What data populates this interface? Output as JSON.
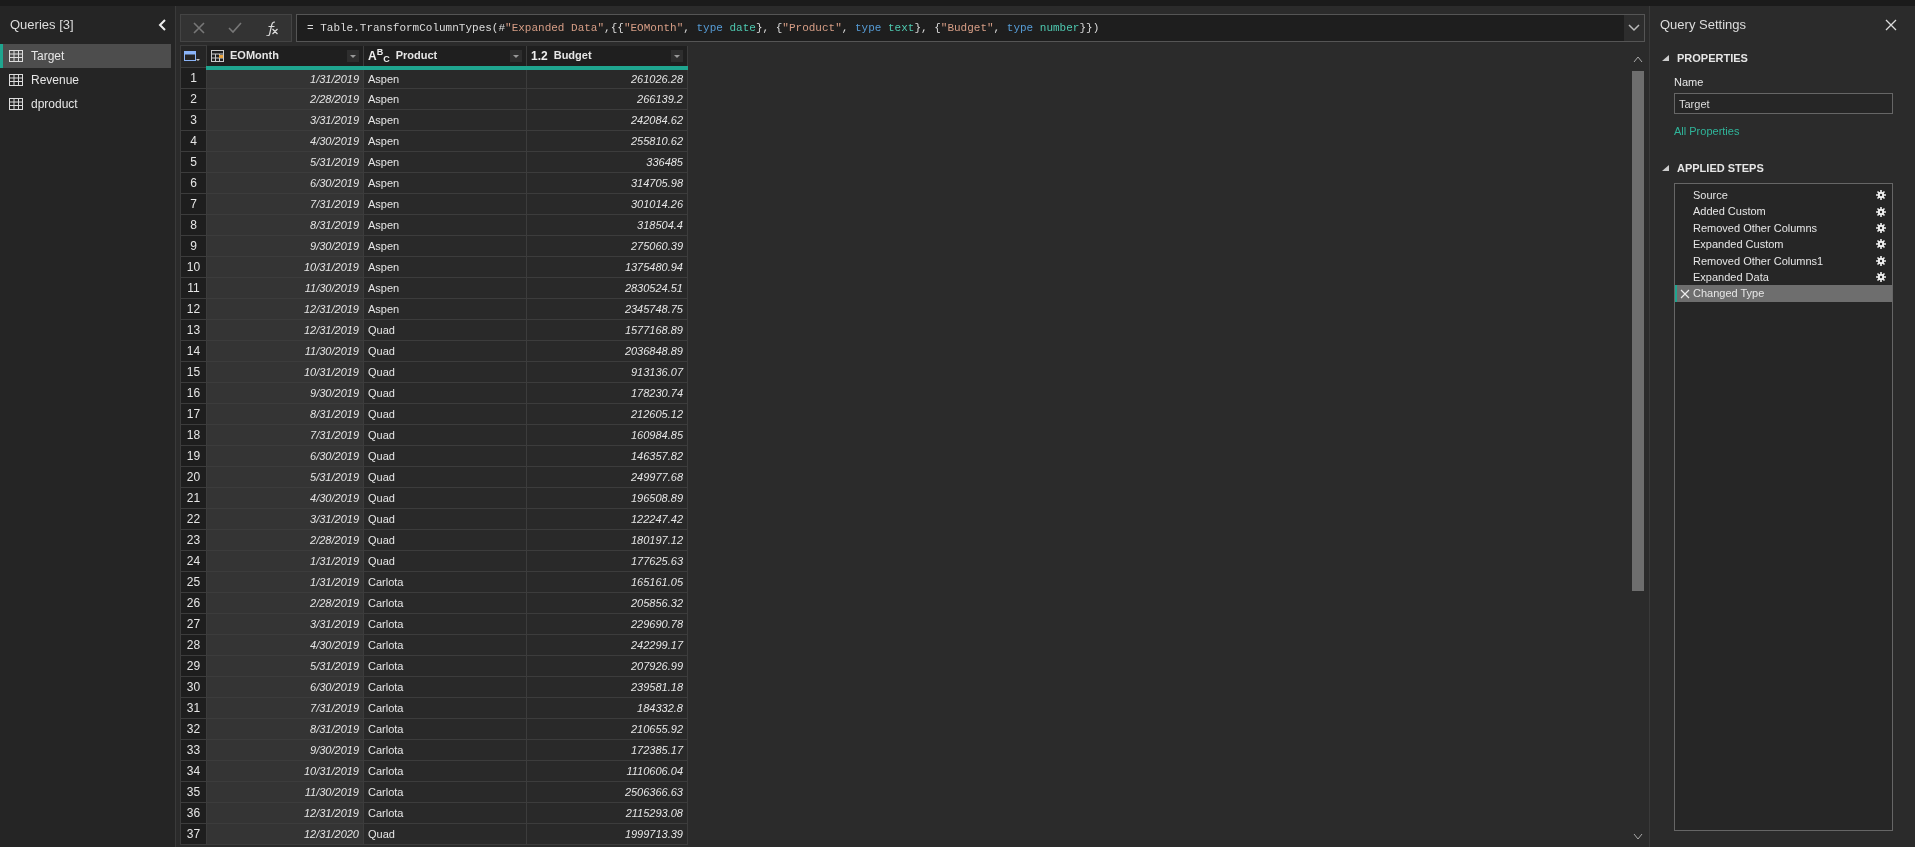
{
  "queries": {
    "title": "Queries [3]",
    "items": [
      {
        "label": "Target",
        "selected": true
      },
      {
        "label": "Revenue",
        "selected": false
      },
      {
        "label": "dproduct",
        "selected": false
      }
    ]
  },
  "formula": [
    {
      "kind": "plain",
      "text": "= Table.TransformColumnTypes(#"
    },
    {
      "kind": "string",
      "text": "\"Expanded Data\""
    },
    {
      "kind": "plain",
      "text": ",{{"
    },
    {
      "kind": "string",
      "text": "\"EOMonth\""
    },
    {
      "kind": "plain",
      "text": ", "
    },
    {
      "kind": "keyword",
      "text": "type"
    },
    {
      "kind": "type",
      "text": " date"
    },
    {
      "kind": "plain",
      "text": "}, {"
    },
    {
      "kind": "string",
      "text": "\"Product\""
    },
    {
      "kind": "plain",
      "text": ", "
    },
    {
      "kind": "keyword",
      "text": "type"
    },
    {
      "kind": "type",
      "text": " text"
    },
    {
      "kind": "plain",
      "text": "}, {"
    },
    {
      "kind": "string",
      "text": "\"Budget\""
    },
    {
      "kind": "plain",
      "text": ", "
    },
    {
      "kind": "keyword",
      "text": "type"
    },
    {
      "kind": "type",
      "text": " number"
    },
    {
      "kind": "plain",
      "text": "}})"
    }
  ],
  "table": {
    "columns": [
      {
        "kind": "select"
      },
      {
        "label": "EOMonth",
        "kind": "date"
      },
      {
        "label": "Product",
        "kind": "text",
        "type_label": "A$^{B}$$_{C}$"
      },
      {
        "label": "Budget",
        "kind": "number",
        "type_label": "1.2"
      }
    ],
    "rows": [
      [
        "1",
        "1/31/2019",
        "Aspen",
        "261026.28"
      ],
      [
        "2",
        "2/28/2019",
        "Aspen",
        "266139.2"
      ],
      [
        "3",
        "3/31/2019",
        "Aspen",
        "242084.62"
      ],
      [
        "4",
        "4/30/2019",
        "Aspen",
        "255810.62"
      ],
      [
        "5",
        "5/31/2019",
        "Aspen",
        "336485"
      ],
      [
        "6",
        "6/30/2019",
        "Aspen",
        "314705.98"
      ],
      [
        "7",
        "7/31/2019",
        "Aspen",
        "301014.26"
      ],
      [
        "8",
        "8/31/2019",
        "Aspen",
        "318504.4"
      ],
      [
        "9",
        "9/30/2019",
        "Aspen",
        "275060.39"
      ],
      [
        "10",
        "10/31/2019",
        "Aspen",
        "1375480.94"
      ],
      [
        "11",
        "11/30/2019",
        "Aspen",
        "2830524.51"
      ],
      [
        "12",
        "12/31/2019",
        "Aspen",
        "2345748.75"
      ],
      [
        "13",
        "12/31/2019",
        "Quad",
        "1577168.89"
      ],
      [
        "14",
        "11/30/2019",
        "Quad",
        "2036848.89"
      ],
      [
        "15",
        "10/31/2019",
        "Quad",
        "913136.07"
      ],
      [
        "16",
        "9/30/2019",
        "Quad",
        "178230.74"
      ],
      [
        "17",
        "8/31/2019",
        "Quad",
        "212605.12"
      ],
      [
        "18",
        "7/31/2019",
        "Quad",
        "160984.85"
      ],
      [
        "19",
        "6/30/2019",
        "Quad",
        "146357.82"
      ],
      [
        "20",
        "5/31/2019",
        "Quad",
        "249977.68"
      ],
      [
        "21",
        "4/30/2019",
        "Quad",
        "196508.89"
      ],
      [
        "22",
        "3/31/2019",
        "Quad",
        "122247.42"
      ],
      [
        "23",
        "2/28/2019",
        "Quad",
        "180197.12"
      ],
      [
        "24",
        "1/31/2019",
        "Quad",
        "177625.63"
      ],
      [
        "25",
        "1/31/2019",
        "Carlota",
        "165161.05"
      ],
      [
        "26",
        "2/28/2019",
        "Carlota",
        "205856.32"
      ],
      [
        "27",
        "3/31/2019",
        "Carlota",
        "229690.78"
      ],
      [
        "28",
        "4/30/2019",
        "Carlota",
        "242299.17"
      ],
      [
        "29",
        "5/31/2019",
        "Carlota",
        "207926.99"
      ],
      [
        "30",
        "6/30/2019",
        "Carlota",
        "239581.18"
      ],
      [
        "31",
        "7/31/2019",
        "Carlota",
        "184332.8"
      ],
      [
        "32",
        "8/31/2019",
        "Carlota",
        "210655.92"
      ],
      [
        "33",
        "9/30/2019",
        "Carlota",
        "172385.17"
      ],
      [
        "34",
        "10/31/2019",
        "Carlota",
        "1110606.04"
      ],
      [
        "35",
        "11/30/2019",
        "Carlota",
        "2506366.63"
      ],
      [
        "36",
        "12/31/2019",
        "Carlota",
        "2115293.08"
      ],
      [
        "37",
        "12/31/2020",
        "Quad",
        "1999713.39"
      ]
    ]
  },
  "settings": {
    "title": "Query Settings",
    "properties_heading": "PROPERTIES",
    "name_label": "Name",
    "name_value": "Target",
    "all_properties": "All Properties",
    "steps_heading": "APPLIED STEPS",
    "steps": [
      {
        "label": "Source",
        "has_settings": true,
        "selected": false
      },
      {
        "label": "Added Custom",
        "has_settings": true,
        "selected": false
      },
      {
        "label": "Removed Other Columns",
        "has_settings": true,
        "selected": false
      },
      {
        "label": "Expanded Custom",
        "has_settings": true,
        "selected": false
      },
      {
        "label": "Removed Other Columns1",
        "has_settings": true,
        "selected": false
      },
      {
        "label": "Expanded Data",
        "has_settings": true,
        "selected": false
      },
      {
        "label": "Changed Type",
        "has_settings": false,
        "selected": true
      }
    ]
  }
}
